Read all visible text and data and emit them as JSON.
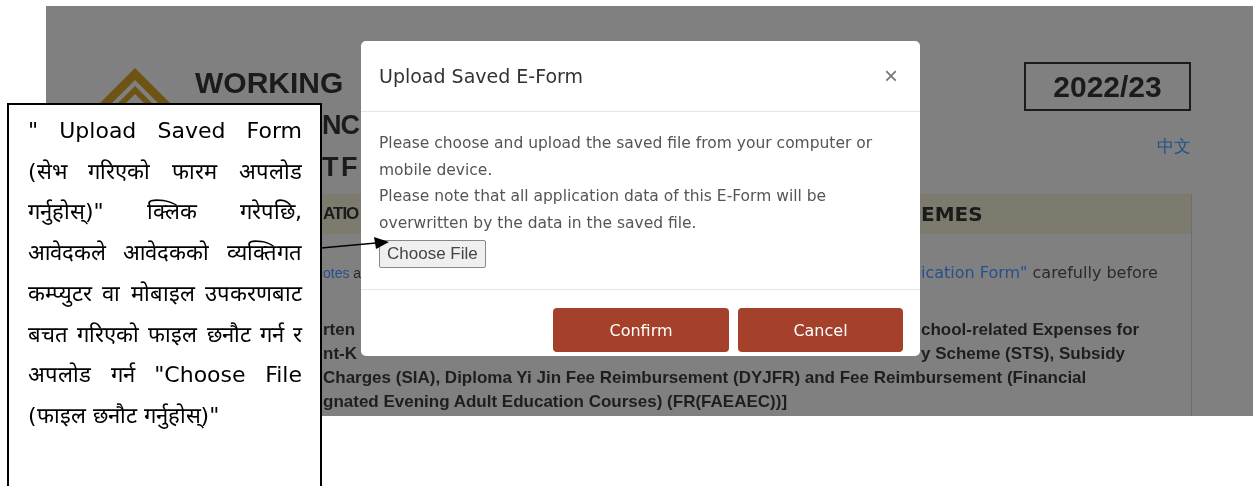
{
  "background_page": {
    "title_lines": [
      "WORKING",
      "NC",
      "T F"
    ],
    "year": "2022/23",
    "language_link": "中文",
    "section_header": {
      "left": "ATIO",
      "right": "EMES"
    },
    "intro": {
      "left": [
        {
          "text": "otes",
          "link": true
        },
        {
          "text": " a",
          "link": false
        }
      ],
      "right": [
        {
          "text": "ication Form\"",
          "link": true
        },
        {
          "text": " carefully before",
          "link": false
        }
      ]
    },
    "scheme_lines": [
      {
        "left": "rten",
        "right": "chool-related Expenses for"
      },
      {
        "left": "nt-K",
        "right": "y Scheme (STS), Subsidy"
      },
      {
        "left": "Charges (SIA), Diploma Yi Jin Fee Reimbursement (DYJFR) and Fee Reimbursement (Financial"
      },
      {
        "left": "gnated Evening Adult Education Courses) (FR(FAEAEC))]"
      }
    ]
  },
  "modal": {
    "title": "Upload Saved E-Form",
    "close": "×",
    "paragraphs": [
      "Please choose and upload the saved file from your computer or mobile device.",
      "Please note that all application data of this E-Form will be overwritten by the data in the saved file."
    ],
    "file_button": "Choose File",
    "buttons": [
      "Confirm",
      "Cancel"
    ]
  },
  "callout": {
    "text": "\" Upload Saved Form (सेभ गरिएको फारम अपलोड गर्नुहोस्)\" क्लिक गरेपछि, आवेदकले आवेदकको व्यक्तिगत कम्प्युटर वा मोबाइल उपकरणबाट बचत गरिएको फाइल छनौट गर्न र अपलोड गर्न \"Choose File (फाइल छनौट गर्नुहोस्)\""
  }
}
